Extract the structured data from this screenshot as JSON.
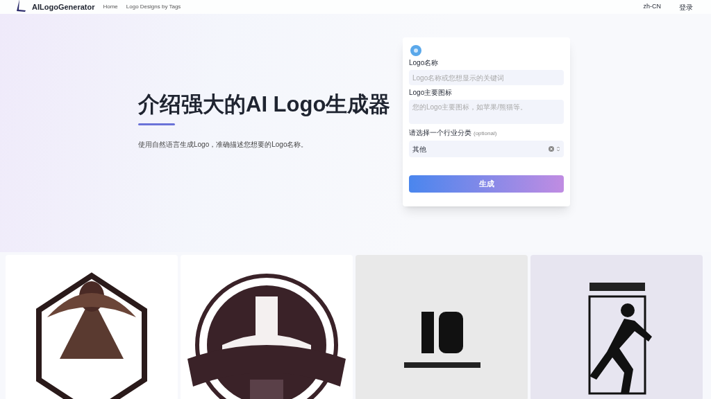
{
  "nav": {
    "brand": "AILogoGenerator",
    "links": [
      "Home",
      "Logo Designs by Tags"
    ],
    "language": "zh-CN",
    "login": "登录"
  },
  "hero": {
    "title": "介绍强大的AI Logo生成器",
    "subtitle": "使用自然语言生成Logo，准确描述您想要的Logo名称。"
  },
  "form": {
    "name_label": "Logo名称",
    "name_placeholder": "Logo名称或您想显示的关键词",
    "icon_label": "Logo主要图标",
    "icon_placeholder": "您的Logo主要图标，如苹果/熊猫等。",
    "category_label": "请选择一个行业分类",
    "category_hint": "(optional)",
    "category_value": "其他",
    "submit": "生成"
  }
}
